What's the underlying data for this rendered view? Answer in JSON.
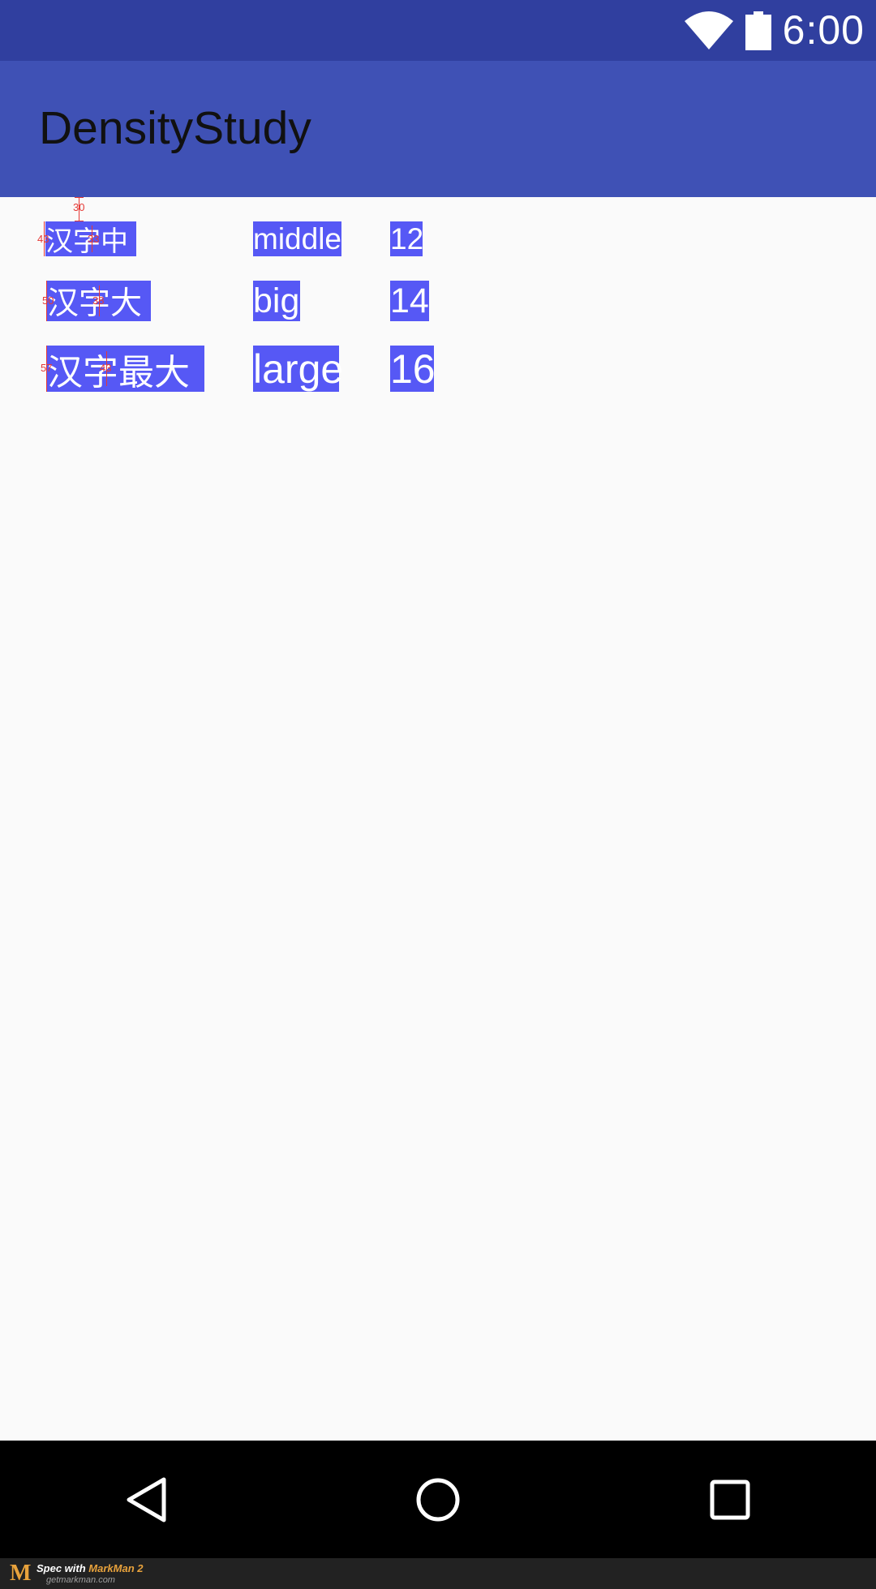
{
  "status_bar": {
    "time": "6:00",
    "icons": [
      "wifi-icon",
      "battery-icon"
    ],
    "color": "#303F9F"
  },
  "app_bar": {
    "title": "DensityStudy",
    "color": "#3F51B5"
  },
  "rows": [
    {
      "chinese": "汉字中",
      "english": "middle",
      "number": "12"
    },
    {
      "chinese": "汉字大",
      "english": "big",
      "number": "14"
    },
    {
      "chinese": "汉字最大",
      "english": "large",
      "number": "16"
    }
  ],
  "spec_annotations": {
    "top_gap": "30",
    "row1_height": "43",
    "row1_glyph": "33",
    "row2_height": "50",
    "row2_glyph": "38",
    "row3_height": "57",
    "row3_glyph": "43"
  },
  "nav_bar": {
    "icons": [
      "back-icon",
      "home-icon",
      "recents-icon"
    ]
  },
  "watermark": {
    "prefix": "Spec with ",
    "brand": "MarkMan 2",
    "url": "getmarkman.com"
  },
  "colors": {
    "cell_background": "#5658F5",
    "annotation": "#E53935"
  }
}
